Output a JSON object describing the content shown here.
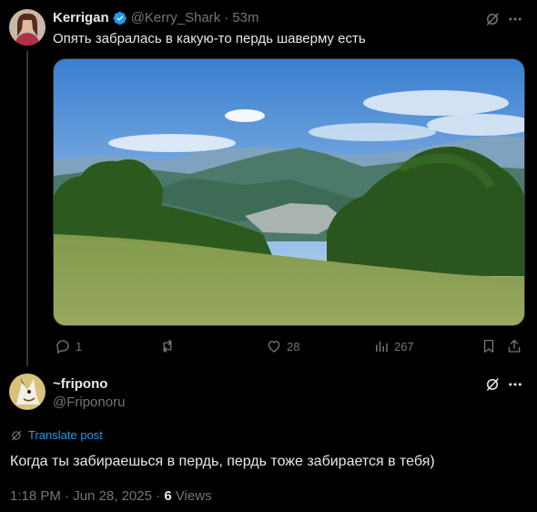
{
  "tweet": {
    "author_name": "Kerrigan",
    "handle": "@Kerry_Shark",
    "separator": "·",
    "time": "53m",
    "text": "Опять забралась в какую-то пердь шаверму есть",
    "actions": {
      "replies": "1",
      "retweets": "",
      "likes": "28",
      "views": "267"
    }
  },
  "reply": {
    "author_name": "~fripono",
    "handle": "@Friponoru",
    "translate_label": "Translate post",
    "text": "Когда ты забираешься в пердь, пердь тоже забирается в тебя)",
    "meta": {
      "time": "1:18 PM",
      "separator1": "·",
      "date": "Jun 28, 2025",
      "separator2": "·",
      "views_count": "6",
      "views_label": "Views"
    }
  },
  "colors": {
    "background": "#000000",
    "text": "#e7e9ea",
    "muted": "#71767b",
    "accent": "#1d9bf0",
    "border": "#2f3336"
  }
}
